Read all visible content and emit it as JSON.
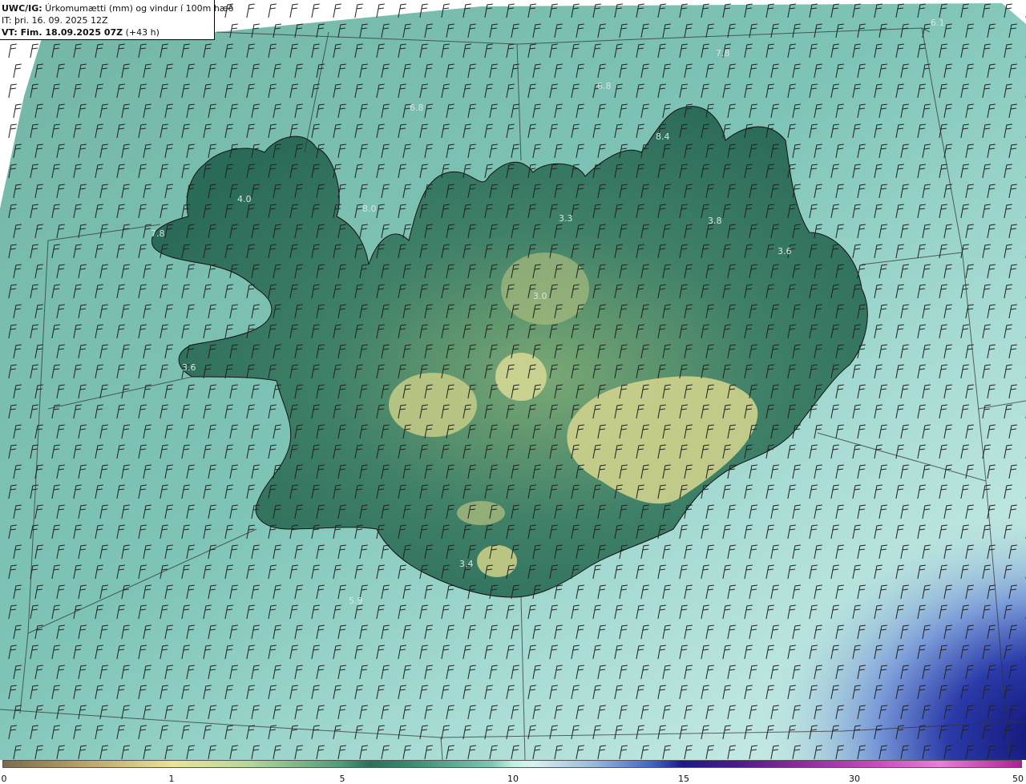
{
  "title": {
    "line1_bold": "UWC/IG:",
    "line1_rest": " Úrkomumætti (mm) og vindur í 100m hæð",
    "line2": "IT: þri. 16. 09. 2025 12Z",
    "line3_bold": "VT: Fim. 18.09.2025 07Z",
    "line3_rest": " (+43 h)"
  },
  "map_labels": [
    {
      "text": "6.1"
    },
    {
      "text": "7.8"
    },
    {
      "text": "6.8"
    },
    {
      "text": "6.8"
    },
    {
      "text": "8.4"
    },
    {
      "text": "4.0"
    },
    {
      "text": "8.0"
    },
    {
      "text": "7.8"
    },
    {
      "text": "3.3"
    },
    {
      "text": "3.8"
    },
    {
      "text": "3.6"
    },
    {
      "text": "3.0"
    },
    {
      "text": "3.6"
    },
    {
      "text": "3.4"
    },
    {
      "text": "5.9"
    }
  ],
  "colorbar": {
    "ticks": [
      "0",
      "1",
      "5",
      "10",
      "15",
      "30",
      "50"
    ]
  },
  "colors": {
    "land_low": "#2d6f5a",
    "land_high": "#c9cf86",
    "sea": "#7fc2b4",
    "heavy_precip": "#1a1a7a",
    "coast_line": "#111111"
  }
}
